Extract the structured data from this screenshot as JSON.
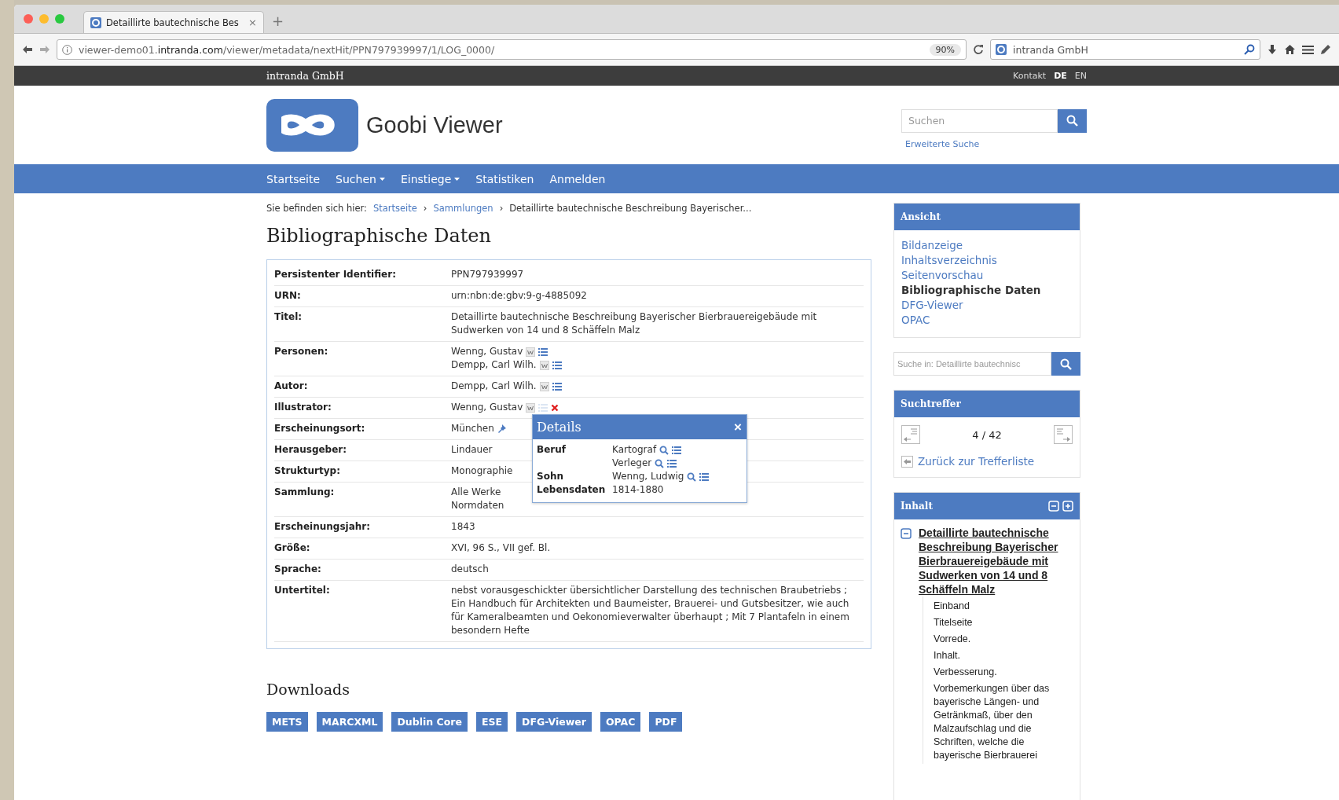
{
  "browser": {
    "tab_title": "Detaillirte bautechnische Bes",
    "tab_close": "×",
    "new_tab": "+",
    "url": "viewer-demo01.**intranda.com**/viewer/metadata/nextHit/PPN797939997/1/LOG_0000/",
    "zoom": "90%",
    "search_value": "intranda GmbH"
  },
  "topbar": {
    "brand": "intranda GmbH",
    "contact": "Kontakt",
    "languages": [
      {
        "label": "DE",
        "selected": true
      },
      {
        "label": "EN",
        "selected": false
      }
    ]
  },
  "header": {
    "logo": "Goobi Viewer",
    "search": {
      "placeholder": "Suchen"
    },
    "advanced_search": "Erweiterte Suche"
  },
  "nav": [
    {
      "label": "Startseite",
      "dropdown": false
    },
    {
      "label": "Suchen",
      "dropdown": true
    },
    {
      "label": "Einstiege",
      "dropdown": true
    },
    {
      "label": "Statistiken",
      "dropdown": false
    },
    {
      "label": "Anmelden",
      "dropdown": false
    }
  ],
  "breadcrumb": {
    "label": "Sie befinden sich hier:",
    "separator": "›",
    "links": [
      "Startseite",
      "Sammlungen"
    ],
    "current": "Detaillirte bautechnische Beschreibung Bayerischer..."
  },
  "title": "Bibliographische Daten",
  "metadata": [
    {
      "label": "Persistenter Identifier:",
      "values": [
        {
          "text": "PPN797939997"
        }
      ]
    },
    {
      "label": "URN:",
      "values": [
        {
          "text": "urn:nbn:de:gbv:9-g-4885092"
        }
      ]
    },
    {
      "label": "Titel:",
      "values": [
        {
          "text": "Detaillirte bautechnische Beschreibung Bayerischer Bierbrauereigebäude mit Sudwerken von 14 und 8 Schäffeln Malz"
        }
      ]
    },
    {
      "label": "Personen:",
      "values": [
        {
          "text": "Wenng, Gustav",
          "kind": "person"
        },
        {
          "text": "Dempp, Carl Wilh.",
          "kind": "person"
        }
      ]
    },
    {
      "label": "Autor:",
      "values": [
        {
          "text": "Dempp, Carl Wilh.",
          "kind": "person"
        }
      ]
    },
    {
      "label": "Illustrator:",
      "values": [
        {
          "text": "Wenng, Gustav",
          "kind": "person_removable"
        }
      ]
    },
    {
      "label": "Erscheinungsort:",
      "values": [
        {
          "text": "München",
          "kind": "place"
        }
      ]
    },
    {
      "label": "Herausgeber:",
      "values": [
        {
          "text": "Lindauer"
        }
      ]
    },
    {
      "label": "Strukturtyp:",
      "values": [
        {
          "text": "Monographie"
        }
      ]
    },
    {
      "label": "Sammlung:",
      "values": [
        {
          "text": "Alle Werke"
        },
        {
          "text": "Normdaten"
        }
      ]
    },
    {
      "label": "Erscheinungsjahr:",
      "values": [
        {
          "text": "1843"
        }
      ]
    },
    {
      "label": "Größe:",
      "values": [
        {
          "text": "XVI, 96 S., VII gef. Bl."
        }
      ]
    },
    {
      "label": "Sprache:",
      "values": [
        {
          "text": "deutsch"
        }
      ]
    },
    {
      "label": "Untertitel:",
      "values": [
        {
          "text": "nebst vorausgeschickter übersichtlicher Darstellung des technischen Braubetriebs ; Ein Handbuch für Architekten und Baumeister, Brauerei- und Gutsbesitzer, wie auch für Kameralbeamten und Oekonomieverwalter überhaupt ; Mit 7 Plantafeln in einem besondern Hefte"
        }
      ]
    }
  ],
  "details_popup": {
    "title": "Details",
    "close": "×",
    "rows": [
      {
        "label": "Beruf",
        "values": [
          {
            "text": "Kartograf",
            "kind": "searchable"
          },
          {
            "text": "Verleger",
            "kind": "searchable"
          }
        ]
      },
      {
        "label": "Sohn",
        "values": [
          {
            "text": "Wenng, Ludwig",
            "kind": "searchable"
          }
        ]
      },
      {
        "label": "Lebensdaten",
        "values": [
          {
            "text": "1814-1880"
          }
        ]
      }
    ]
  },
  "downloads": {
    "title": "Downloads",
    "buttons": [
      "METS",
      "MARCXML",
      "Dublin Core",
      "ESE",
      "DFG-Viewer",
      "OPAC",
      "PDF"
    ]
  },
  "sidebar": {
    "views": {
      "title": "Ansicht",
      "items": [
        {
          "label": "Bildanzeige",
          "selected": false
        },
        {
          "label": "Inhaltsverzeichnis",
          "selected": false
        },
        {
          "label": "Seitenvorschau",
          "selected": false
        },
        {
          "label": "Bibliographische Daten",
          "selected": true
        },
        {
          "label": "DFG-Viewer",
          "selected": false
        },
        {
          "label": "OPAC",
          "selected": false
        }
      ]
    },
    "search_in": {
      "placeholder": "Suche in: Detaillirte bautechnisc"
    },
    "hits": {
      "title": "Suchtreffer",
      "counter": "4 / 42",
      "back_link": "Zurück zur Trefferliste"
    },
    "contents": {
      "title": "Inhalt",
      "tree": [
        {
          "label": "Detaillirte bautechnische Beschreibung Bayerischer Bierbrauereigebäude mit Sudwerken von 14 und 8 Schäffeln Malz",
          "expanded": true,
          "children": [
            {
              "label": "Einband"
            },
            {
              "label": "Titelseite"
            },
            {
              "label": "Vorrede."
            },
            {
              "label": "Inhalt."
            },
            {
              "label": "Verbesserung."
            },
            {
              "label": "Vorbemerkungen über das bayerische Längen- und Getränkmaß, über den Malzaufschlag und die Schriften, welche die bayerische Bierbrauerei"
            }
          ]
        }
      ]
    }
  }
}
